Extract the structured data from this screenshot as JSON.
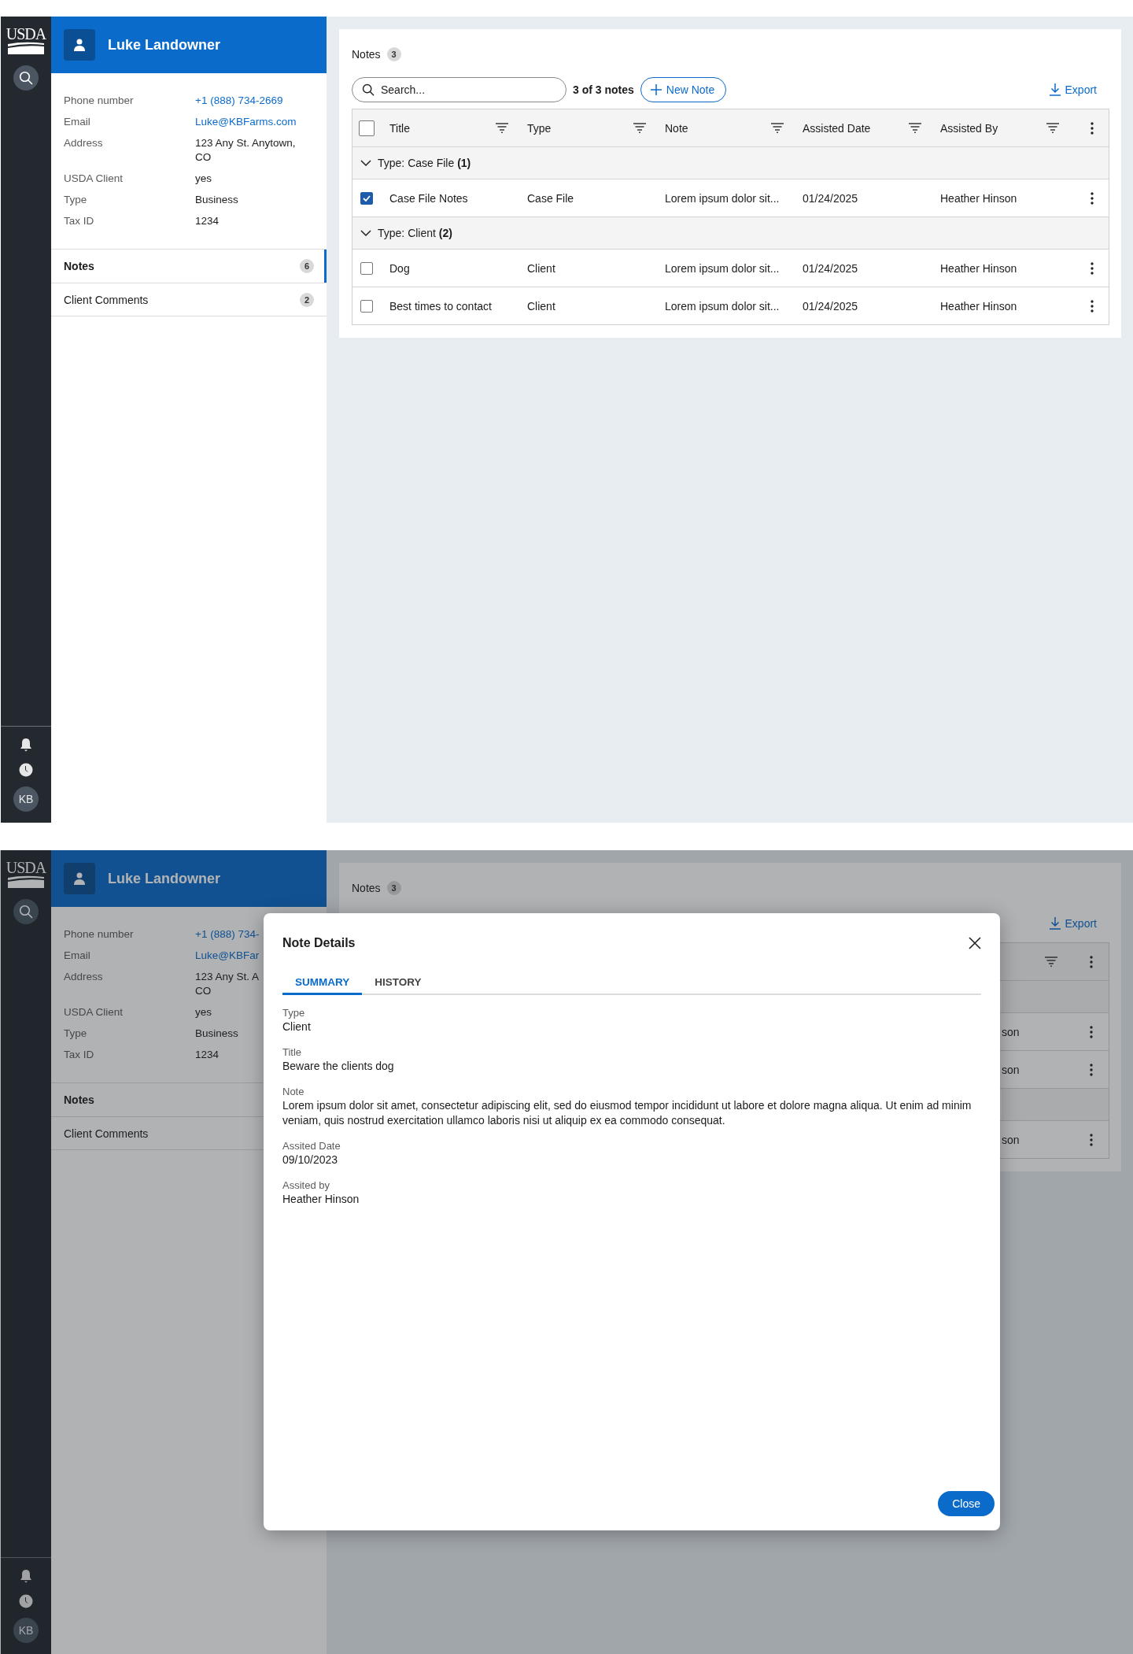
{
  "main_view": {
    "nav_rail": {
      "logo": "USDA",
      "avatar": "KB"
    },
    "client": {
      "name": "Luke Landowner",
      "details": [
        {
          "label": "Phone number",
          "value": "+1 (888) 734-2669",
          "kind": "link"
        },
        {
          "label": "Email",
          "value": "Luke@KBFarms.com",
          "kind": "link"
        },
        {
          "label": "Address",
          "value": "123 Any St. Anytown, CO",
          "kind": "text"
        },
        {
          "label": "USDA Client",
          "value": "yes",
          "kind": "text"
        },
        {
          "label": "Type",
          "value": "Business",
          "kind": "text"
        },
        {
          "label": "Tax ID",
          "value": "1234",
          "kind": "text"
        }
      ],
      "nav": [
        {
          "label": "Notes",
          "count": "6",
          "selected": true
        },
        {
          "label": "Client Comments",
          "count": "2",
          "selected": false
        }
      ]
    },
    "notes": {
      "title": "Notes",
      "count": "3",
      "search": {
        "placeholder": "Search..."
      },
      "result_count": "3 of 3 notes",
      "new_button": "New Note",
      "export": "Export",
      "table": {
        "select_all_checked": false,
        "columns": [
          "Title",
          "Type",
          "Note",
          "Assisted Date",
          "Assisted By"
        ],
        "groups": [
          {
            "label": "Type: Case File **(1)**",
            "expanded": true,
            "rows": [
              {
                "checked": true,
                "cells": [
                  "Case File Notes",
                  "Case File",
                  "Lorem ipsum dolor sit...",
                  "01/24/2025",
                  "Heather Hinson"
                ]
              }
            ]
          },
          {
            "label": "Type: Client **(2)**",
            "expanded": true,
            "rows": [
              {
                "checked": false,
                "cells": [
                  "Dog",
                  "Client",
                  "Lorem ipsum dolor sit...",
                  "01/24/2025",
                  "Heather Hinson"
                ]
              },
              {
                "checked": false,
                "cells": [
                  "Best times to contact",
                  "Client",
                  "Lorem ipsum dolor sit...",
                  "01/24/2025",
                  "Heather Hinson"
                ]
              }
            ]
          }
        ]
      }
    }
  },
  "dialog_view": {
    "nav_rail": {
      "logo": "USDA",
      "avatar": "KB"
    },
    "client": {
      "name": "Luke Landowner",
      "details": [
        {
          "label": "Phone number",
          "lines": [
            "+1 (888) 734-"
          ],
          "kind": "link"
        },
        {
          "label": "Email",
          "lines": [
            "Luke@KBFar"
          ],
          "kind": "link"
        },
        {
          "label": "Address",
          "lines": [
            "123 Any St. A",
            "CO"
          ],
          "kind": "text"
        },
        {
          "label": "USDA Client",
          "lines": [
            "yes"
          ],
          "kind": "text"
        },
        {
          "label": "Type",
          "lines": [
            "Business"
          ],
          "kind": "text"
        },
        {
          "label": "Tax ID",
          "lines": [
            "1234"
          ],
          "kind": "text"
        }
      ],
      "nav": [
        {
          "label": "Notes",
          "selected": true
        },
        {
          "label": "Client Comments",
          "selected": false
        }
      ]
    },
    "notes": {
      "title": "Notes",
      "count": "3",
      "export": "Export",
      "row_fragments": [
        "son",
        "son",
        "son"
      ]
    },
    "modal": {
      "title": "Note Details",
      "tabs": [
        {
          "label": "SUMMARY",
          "selected": true
        },
        {
          "label": "HISTORY",
          "selected": false
        }
      ],
      "fields": [
        {
          "label": "Type",
          "value": "Client"
        },
        {
          "label": "Title",
          "value": "Beware the clients dog"
        },
        {
          "label": "Note",
          "value": "Lorem ipsum dolor sit amet, consectetur adipiscing elit, sed do eiusmod tempor incididunt ut labore et dolore magna aliqua. Ut enim ad minim veniam, quis nostrud exercitation ullamco laboris nisi ut aliquip ex ea commodo consequat."
        },
        {
          "label": "Assited Date",
          "value": "09/10/2023"
        },
        {
          "label": "Assited by",
          "value": "Heather Hinson"
        }
      ],
      "close_button": "Close"
    }
  }
}
